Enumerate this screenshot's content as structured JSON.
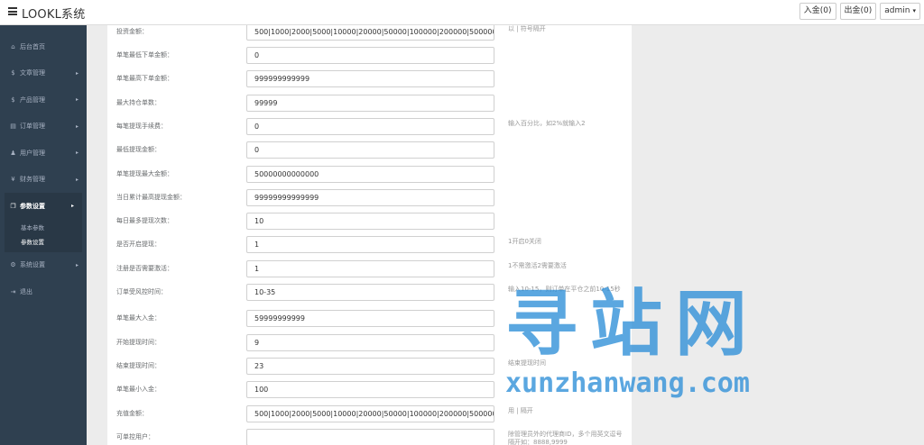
{
  "app": {
    "brand": "LOOKL系统"
  },
  "topbar": {
    "deposit": "入金(0)",
    "withdraw": "出金(0)",
    "user": "admin"
  },
  "sidebar": {
    "items": [
      {
        "label": "后台首页",
        "icon": "dashboard-icon",
        "glyph": "⌂"
      },
      {
        "label": "文章管理",
        "icon": "dollar-icon",
        "glyph": "$"
      },
      {
        "label": "产品管理",
        "icon": "dollar-icon",
        "glyph": "$"
      },
      {
        "label": "订单管理",
        "icon": "file-icon",
        "glyph": "▤"
      },
      {
        "label": "用户管理",
        "icon": "user-icon",
        "glyph": "♟"
      },
      {
        "label": "财务管理",
        "icon": "yen-icon",
        "glyph": "¥"
      },
      {
        "label": "参数设置",
        "icon": "copy-icon",
        "glyph": "❐"
      },
      {
        "label": "系统设置",
        "icon": "cogs-icon",
        "glyph": "⚙"
      },
      {
        "label": "退出",
        "icon": "sign-out-icon",
        "glyph": "⇥"
      }
    ],
    "subitems": [
      "基本参数",
      "参数设置"
    ]
  },
  "form": {
    "rows": [
      {
        "label": "投资金额：",
        "value": "500|1000|2000|5000|10000|20000|50000|100000|200000|500000",
        "help": "以 | 符号隔开"
      },
      {
        "label": "单笔最低下单金额：",
        "value": "0",
        "help": ""
      },
      {
        "label": "单笔最高下单金额：",
        "value": "999999999999",
        "help": ""
      },
      {
        "label": "最大持仓单数：",
        "value": "99999",
        "help": ""
      },
      {
        "label": "每笔提现手续费：",
        "value": "0",
        "help": "输入百分比，如2%就输入2"
      },
      {
        "label": "最低提现金额：",
        "value": "0",
        "help": ""
      },
      {
        "label": "单笔提现最大金额：",
        "value": "50000000000000",
        "help": ""
      },
      {
        "label": "当日累计最高提现金额：",
        "value": "99999999999999",
        "help": ""
      },
      {
        "label": "每日最多提现次数：",
        "value": "10",
        "help": ""
      },
      {
        "label": "是否开启提现：",
        "value": "1",
        "help": "1开启0关闭"
      },
      {
        "label": "注册是否需要激活：",
        "value": "1",
        "help": "1不需激活2需要激活"
      },
      {
        "label": "订单受风控时间：",
        "value": "10-35",
        "help": "输入10-15，则订单在平仓之前10-15秒"
      },
      {
        "label": "单笔最大入金：",
        "value": "59999999999",
        "help": ""
      },
      {
        "label": "开始提现时间：",
        "value": "9",
        "help": ""
      },
      {
        "label": "结束提现时间：",
        "value": "23",
        "help": "结束提现时间"
      },
      {
        "label": "单笔最小入金：",
        "value": "100",
        "help": ""
      },
      {
        "label": "充值金额：",
        "value": "500|1000|2000|5000|10000|20000|50000|100000|200000|500000",
        "help": "用 | 隔开"
      },
      {
        "label": "可单控用户：",
        "value": "",
        "help": "除管理员外的代理商ID，多个用英文逗号隔开如：8888,9999"
      }
    ]
  },
  "watermark": {
    "title": "寻站网",
    "url": "xunzhanwang.com"
  },
  "colors": {
    "sidebar": "#2f4050",
    "sidebar_active": "#293846",
    "watermark": "#2e8fd8"
  }
}
